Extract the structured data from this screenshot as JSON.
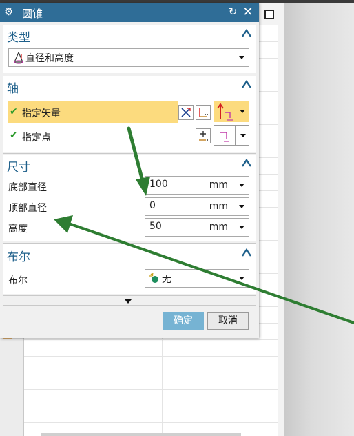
{
  "dialog": {
    "title": "圆锥",
    "type_section": {
      "header": "类型",
      "selected": "直径和高度"
    },
    "axis_section": {
      "header": "轴",
      "specify_vector": "指定矢量",
      "specify_point": "指定点"
    },
    "dimensions_section": {
      "header": "尺寸",
      "rows": [
        {
          "label": "底部直径",
          "value": "100",
          "unit": "mm"
        },
        {
          "label": "顶部直径",
          "value": "0",
          "unit": "mm"
        },
        {
          "label": "高度",
          "value": "50",
          "unit": "mm"
        }
      ]
    },
    "boolean_section": {
      "header": "布尔",
      "label": "布尔",
      "selected": "无"
    },
    "buttons": {
      "ok": "确定",
      "cancel": "取消"
    }
  },
  "icons": [
    "gear-icon",
    "reset-icon",
    "close-icon",
    "collapse-icon",
    "check-icon",
    "vector-icon",
    "point-icon",
    "boolean-none-icon",
    "more-options-icon"
  ],
  "colors": {
    "titlebar": "#2f6d97",
    "section_header": "#1d5f8a",
    "highlight_row": "#fcdb7e",
    "ok_button": "#76b3d3",
    "annotation_arrow": "#2e7d32",
    "check": "#2a9a2a"
  }
}
